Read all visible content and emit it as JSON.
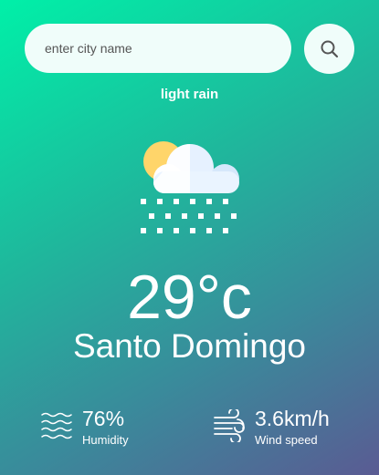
{
  "search": {
    "placeholder": "enter city name",
    "value": "",
    "button_icon": "search-icon"
  },
  "weather": {
    "condition": "light rain",
    "icon": "cloud-sun-rain-icon",
    "temperature": "29°c",
    "city": "Santo Domingo"
  },
  "details": {
    "humidity": {
      "value": "76%",
      "label": "Humidity",
      "icon": "humidity-waves-icon"
    },
    "wind": {
      "value": "3.6km/h",
      "label": "Wind speed",
      "icon": "wind-icon"
    }
  },
  "colors": {
    "gradient_start": "#00f0a8",
    "gradient_end": "#5a5b93",
    "input_bg": "#f0fdfa",
    "text": "#ffffff",
    "sun": "#ffd56a",
    "cloud": "#eaf4ff"
  }
}
